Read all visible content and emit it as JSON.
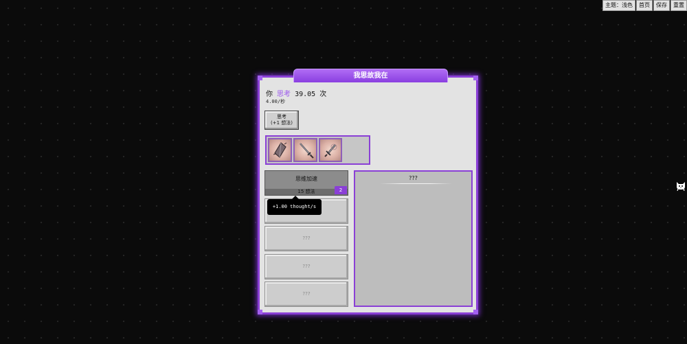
{
  "topbar": {
    "theme_label": "主题：浅色",
    "home_label": "首页",
    "save_label": "保存",
    "reset_label": "重置"
  },
  "tab": {
    "title": "我思故我在"
  },
  "counter": {
    "prefix": "你",
    "verb": "思考",
    "amount": "39.05",
    "suffix": "次",
    "rate": "4.00/秒",
    "verb_color": "#9a55ee"
  },
  "think_button": {
    "line1": "思考",
    "line2": "(+1 想法)"
  },
  "inventory": {
    "items": [
      {
        "icon": "crystal-shard-icon"
      },
      {
        "icon": "sword-icon"
      },
      {
        "icon": "dagger-icon"
      },
      {
        "icon": "empty-slot"
      }
    ]
  },
  "upgrades": {
    "active": {
      "name": "思维加速",
      "cost": "15 想法",
      "level": "2"
    },
    "locked": [
      "???",
      "???",
      "???",
      "???"
    ]
  },
  "tooltip": {
    "text": "+1.00 thought/s"
  },
  "right_panel": {
    "title": "???"
  },
  "colors": {
    "accent": "#8a3fd6",
    "background": "#0b0b0b",
    "panel": "#e3e3e3"
  }
}
